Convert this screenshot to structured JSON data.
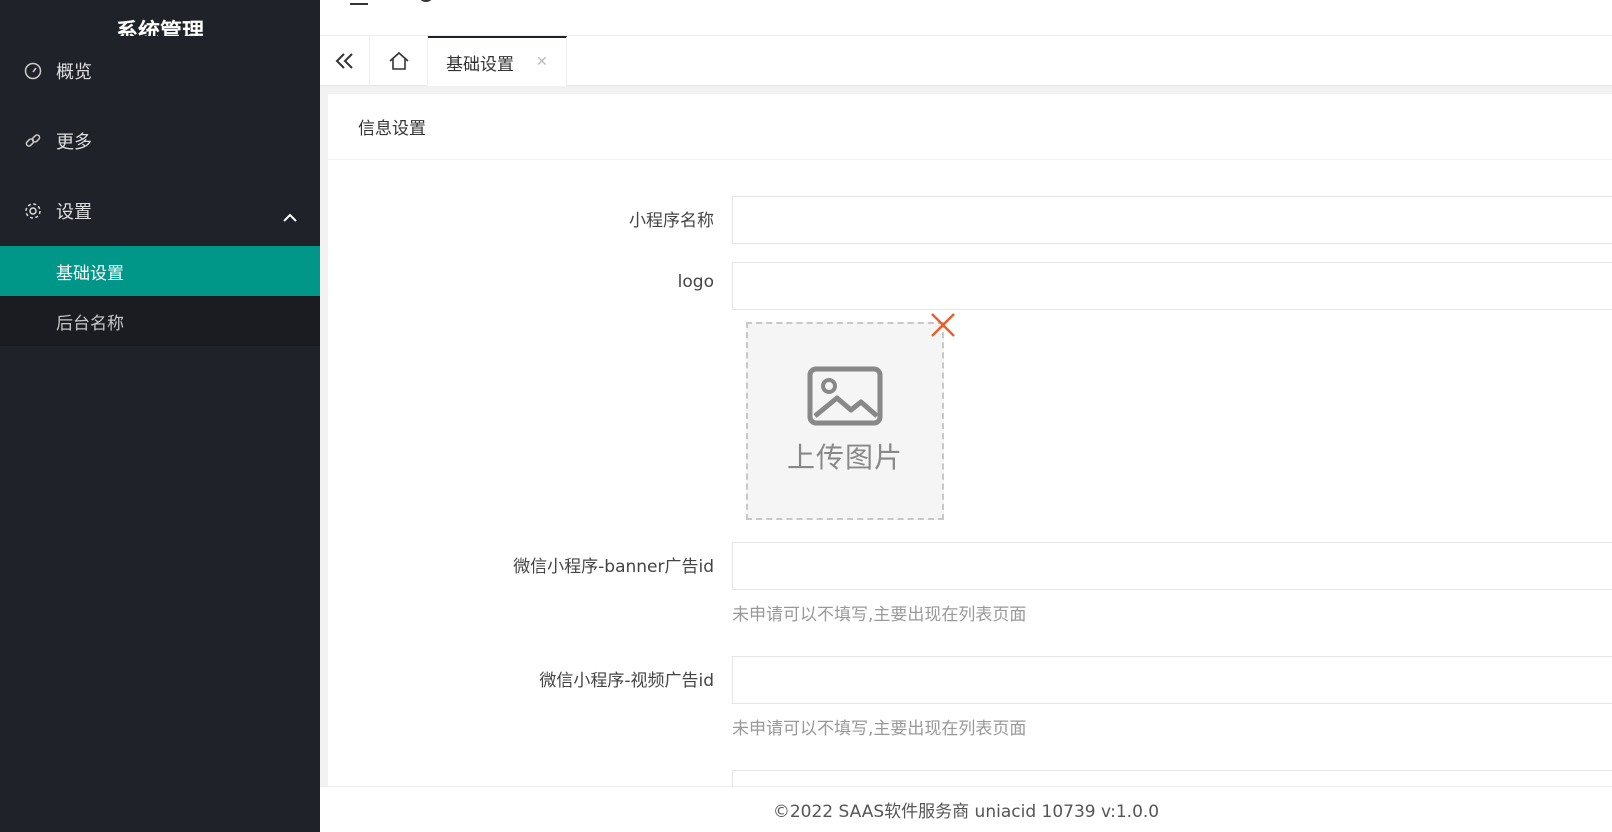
{
  "sidebar": {
    "logo_text": "系统管理",
    "items": [
      {
        "label": "概览",
        "icon": "dashboard-icon"
      },
      {
        "label": "更多",
        "icon": "link-icon"
      },
      {
        "label": "设置",
        "icon": "gear-icon",
        "expanded": true
      }
    ],
    "sub_items": [
      {
        "label": "基础设置",
        "active": true
      },
      {
        "label": "后台名称",
        "active": false
      }
    ]
  },
  "tabs": {
    "items": [
      {
        "label": "基础设置",
        "active": true
      }
    ]
  },
  "card": {
    "title": "信息设置"
  },
  "form": {
    "fields": [
      {
        "label": "小程序名称",
        "value": ""
      },
      {
        "label": "logo",
        "value": ""
      },
      {
        "label": "微信小程序-banner广告id",
        "value": "",
        "hint": "未申请可以不填写,主要出现在列表页面"
      },
      {
        "label": "微信小程序-视频广告id",
        "value": "",
        "hint": "未申请可以不填写,主要出现在列表页面"
      }
    ],
    "upload_text": "上传图片"
  },
  "footer": {
    "text": "©2022 SAAS软件服务商 uniacid 10739   v:1.0.0"
  },
  "colors": {
    "sidebar_bg": "#20222a",
    "active": "#009688",
    "close_icon": "#e6622c"
  }
}
